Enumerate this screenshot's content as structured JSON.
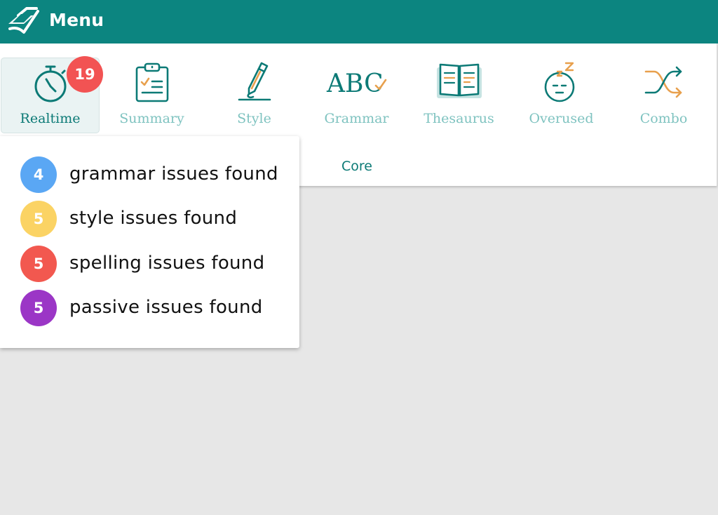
{
  "header": {
    "title": "Menu",
    "logo_icon": "book-logo-icon",
    "background": "#0c8580"
  },
  "toolbar": {
    "tools": [
      {
        "label": "Realtime",
        "icon": "stopwatch-icon",
        "active": true
      },
      {
        "label": "Summary",
        "icon": "clipboard-icon",
        "active": false
      },
      {
        "label": "Style",
        "icon": "pencil-icon",
        "active": false
      },
      {
        "label": "Grammar",
        "icon": "abc-check-icon",
        "active": false
      },
      {
        "label": "Thesaurus",
        "icon": "open-book-icon",
        "active": false
      },
      {
        "label": "Overused",
        "icon": "sleepy-face-icon",
        "active": false
      },
      {
        "label": "Combo",
        "icon": "shuffle-icon",
        "active": false
      }
    ],
    "realtime_badge": "19",
    "group_label": "Core"
  },
  "realtime_popup": {
    "issues": [
      {
        "count": "4",
        "text": "grammar issues found",
        "color": "#5aa7f4"
      },
      {
        "count": "5",
        "text": "style issues found",
        "color": "#fbd364"
      },
      {
        "count": "5",
        "text": "spelling issues found",
        "color": "#f2584f"
      },
      {
        "count": "5",
        "text": "passive issues found",
        "color": "#9b36c6"
      }
    ]
  },
  "colors": {
    "accent": "#0c8580",
    "tool_icon": "#0c7a76",
    "tool_highlight": "#e8a04d",
    "inactive_label": "#7fc3c0",
    "badge": "#f25353"
  }
}
